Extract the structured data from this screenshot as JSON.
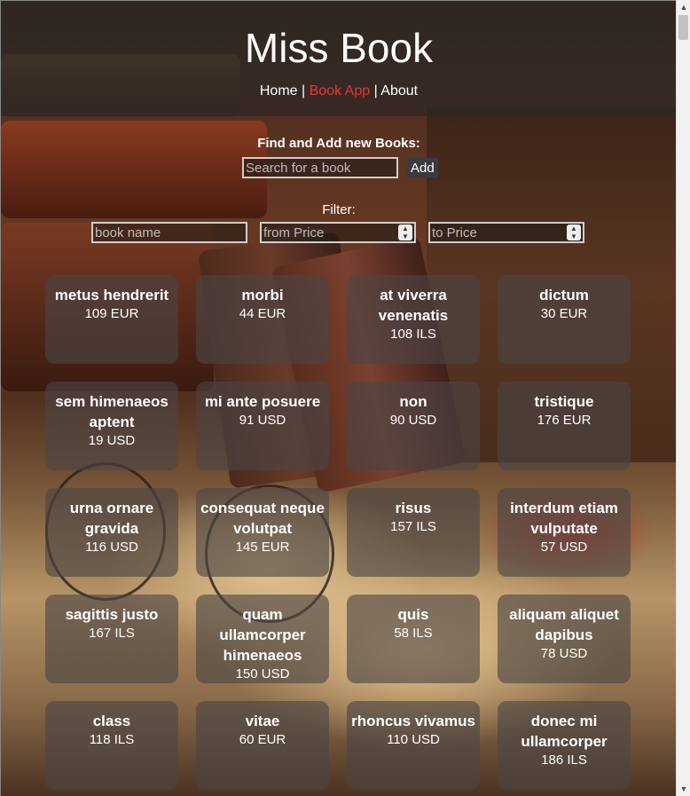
{
  "header": {
    "title": "Miss Book",
    "nav": [
      {
        "label": "Home",
        "active": false
      },
      {
        "label": "Book App",
        "active": true
      },
      {
        "label": "About",
        "active": false
      }
    ],
    "separator": "|"
  },
  "add": {
    "label": "Find and Add new Books:",
    "placeholder": "Search for a book",
    "button": "Add"
  },
  "filter": {
    "label": "Filter:",
    "name_placeholder": "book name",
    "from_placeholder": "from Price",
    "to_placeholder": "to Price"
  },
  "books": [
    {
      "name": "metus hendrerit",
      "price": "109 EUR"
    },
    {
      "name": "morbi",
      "price": "44 EUR"
    },
    {
      "name": "at viverra venenatis",
      "price": "108 ILS"
    },
    {
      "name": "dictum",
      "price": "30 EUR"
    },
    {
      "name": "sem himenaeos aptent",
      "price": "19 USD"
    },
    {
      "name": "mi ante posuere",
      "price": "91 USD"
    },
    {
      "name": "non",
      "price": "90 USD"
    },
    {
      "name": "tristique",
      "price": "176 EUR"
    },
    {
      "name": "urna ornare gravida",
      "price": "116 USD"
    },
    {
      "name": "consequat neque volutpat",
      "price": "145 EUR"
    },
    {
      "name": "risus",
      "price": "157 ILS"
    },
    {
      "name": "interdum etiam vulputate",
      "price": "57 USD"
    },
    {
      "name": "sagittis justo",
      "price": "167 ILS"
    },
    {
      "name": "quam ullamcorper himenaeos",
      "price": "150 USD"
    },
    {
      "name": "quis",
      "price": "58 ILS"
    },
    {
      "name": "aliquam aliquet dapibus",
      "price": "78 USD"
    },
    {
      "name": "class",
      "price": "118 ILS"
    },
    {
      "name": "vitae",
      "price": "60 EUR"
    },
    {
      "name": "rhoncus vivamus",
      "price": "110 USD"
    },
    {
      "name": "donec mi ullamcorper",
      "price": "186 ILS"
    }
  ],
  "colors": {
    "active_nav": "#e53935",
    "card_bg": "rgba(75,70,70,0.62)"
  }
}
